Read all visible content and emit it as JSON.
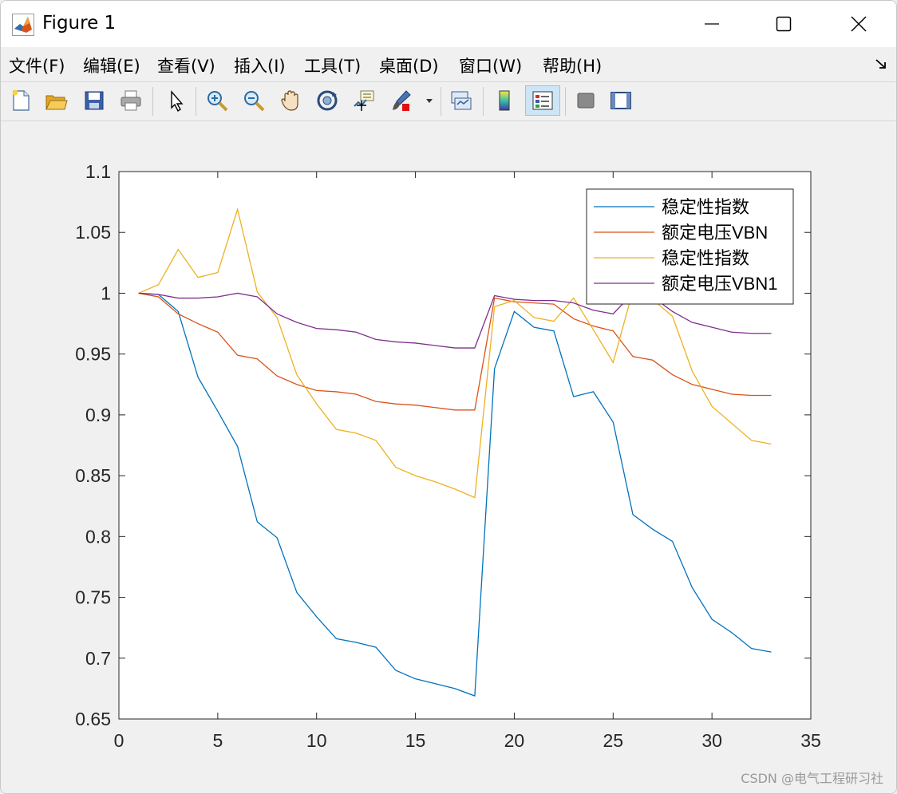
{
  "window": {
    "title": "Figure 1",
    "controls": [
      "minimize",
      "maximize",
      "close"
    ]
  },
  "menu": {
    "items": [
      "文件(F)",
      "编辑(E)",
      "查看(V)",
      "插入(I)",
      "工具(T)",
      "桌面(D)",
      "窗口(W)",
      "帮助(H)"
    ]
  },
  "toolbar": {
    "icons": [
      "new-figure-icon",
      "open-file-icon",
      "save-icon",
      "print-icon",
      "select-arrow-icon",
      "zoom-in-icon",
      "zoom-out-icon",
      "pan-hand-icon",
      "rotate-3d-icon",
      "data-cursor-icon",
      "brush-icon",
      "brush-dropdown-icon",
      "link-plot-icon",
      "colorbar-icon",
      "legend-icon",
      "hide-plot-tools-icon",
      "show-plot-tools-icon"
    ]
  },
  "watermark": "CSDN @电气工程研习社",
  "chart_data": {
    "type": "line",
    "xlim": [
      0,
      35
    ],
    "ylim": [
      0.65,
      1.1
    ],
    "xticks": [
      "0",
      "5",
      "10",
      "15",
      "20",
      "25",
      "30",
      "35"
    ],
    "yticks": [
      "0.65",
      "0.7",
      "0.75",
      "0.8",
      "0.85",
      "0.9",
      "0.95",
      "1",
      "1.05",
      "1.1"
    ],
    "grid": false,
    "legend_position": "top-right",
    "x": [
      1,
      2,
      3,
      4,
      5,
      6,
      7,
      8,
      9,
      10,
      11,
      12,
      13,
      14,
      15,
      16,
      17,
      18,
      19,
      20,
      21,
      22,
      23,
      24,
      25,
      26,
      27,
      28,
      29,
      30,
      31,
      32,
      33
    ],
    "series": [
      {
        "name": "稳定性指数",
        "color": "#0072BD",
        "values": [
          1.0,
          0.999,
          0.985,
          0.931,
          0.903,
          0.874,
          0.812,
          0.799,
          0.754,
          0.734,
          0.716,
          0.713,
          0.709,
          0.69,
          0.683,
          0.679,
          0.675,
          0.669,
          0.938,
          0.985,
          0.972,
          0.969,
          0.915,
          0.919,
          0.894,
          0.818,
          0.806,
          0.796,
          0.758,
          0.732,
          0.721,
          0.708,
          0.705
        ]
      },
      {
        "name": "额定电压VBN",
        "color": "#D95319",
        "values": [
          1.0,
          0.997,
          0.983,
          0.975,
          0.968,
          0.949,
          0.946,
          0.932,
          0.925,
          0.92,
          0.919,
          0.917,
          0.911,
          0.909,
          0.908,
          0.906,
          0.904,
          0.904,
          0.996,
          0.993,
          0.992,
          0.991,
          0.979,
          0.973,
          0.969,
          0.948,
          0.945,
          0.933,
          0.925,
          0.921,
          0.917,
          0.916,
          0.916
        ]
      },
      {
        "name": "稳定性指数",
        "color": "#EDB120",
        "values": [
          1.0,
          1.007,
          1.036,
          1.013,
          1.017,
          1.069,
          1.001,
          0.98,
          0.933,
          0.909,
          0.888,
          0.885,
          0.879,
          0.857,
          0.85,
          0.845,
          0.839,
          0.832,
          0.989,
          0.994,
          0.98,
          0.977,
          0.996,
          0.97,
          0.943,
          1.002,
          0.995,
          0.981,
          0.936,
          0.907,
          0.893,
          0.879,
          0.876
        ]
      },
      {
        "name": "额定电压VBN1",
        "color": "#7E2F8E",
        "values": [
          1.0,
          0.999,
          0.996,
          0.996,
          0.997,
          1.0,
          0.997,
          0.983,
          0.976,
          0.971,
          0.97,
          0.968,
          0.962,
          0.96,
          0.959,
          0.957,
          0.955,
          0.955,
          0.998,
          0.995,
          0.994,
          0.994,
          0.992,
          0.986,
          0.983,
          1.0,
          0.997,
          0.985,
          0.976,
          0.972,
          0.968,
          0.967,
          0.967
        ]
      }
    ]
  }
}
